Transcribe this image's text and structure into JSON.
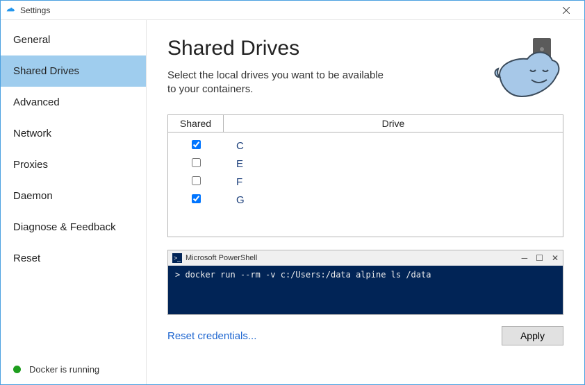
{
  "titlebar": {
    "title": "Settings"
  },
  "sidebar": {
    "items": [
      {
        "label": "General",
        "selected": false
      },
      {
        "label": "Shared Drives",
        "selected": true
      },
      {
        "label": "Advanced",
        "selected": false
      },
      {
        "label": "Network",
        "selected": false
      },
      {
        "label": "Proxies",
        "selected": false
      },
      {
        "label": "Daemon",
        "selected": false
      },
      {
        "label": "Diagnose & Feedback",
        "selected": false
      },
      {
        "label": "Reset",
        "selected": false
      }
    ],
    "status": "Docker is running"
  },
  "main": {
    "heading": "Shared Drives",
    "subtitle": "Select the local drives you want to be available to your containers.",
    "table": {
      "col_shared": "Shared",
      "col_drive": "Drive",
      "rows": [
        {
          "drive": "C",
          "shared": true
        },
        {
          "drive": "E",
          "shared": false
        },
        {
          "drive": "F",
          "shared": false
        },
        {
          "drive": "G",
          "shared": true
        }
      ]
    },
    "powershell": {
      "title": "Microsoft PowerShell",
      "command": "> docker run --rm -v c:/Users:/data alpine ls /data"
    },
    "reset_link": "Reset credentials...",
    "apply_label": "Apply"
  }
}
